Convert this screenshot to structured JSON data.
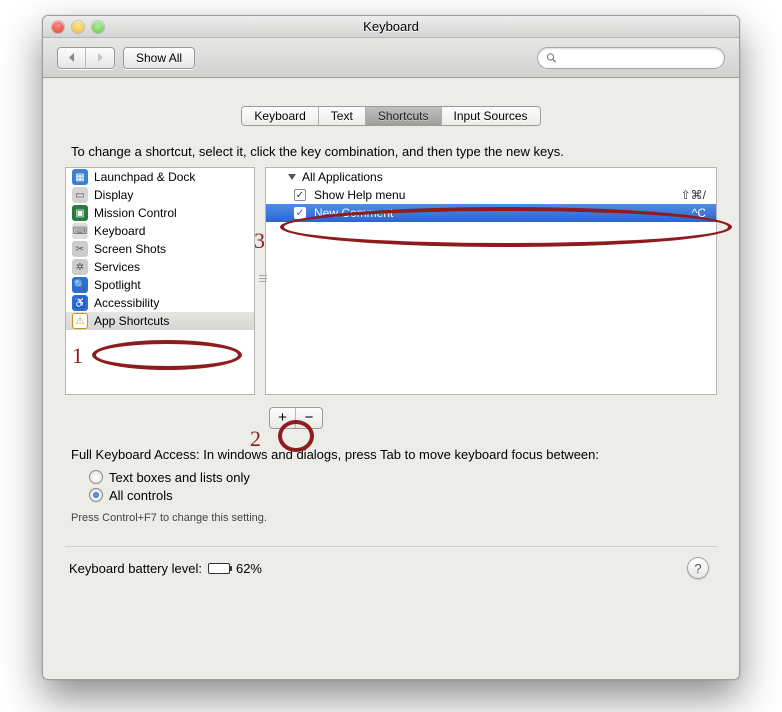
{
  "window": {
    "title": "Keyboard"
  },
  "toolbar": {
    "showAll": "Show All",
    "searchPlaceholder": ""
  },
  "tabs": {
    "items": [
      "Keyboard",
      "Text",
      "Shortcuts",
      "Input Sources"
    ],
    "activeIndex": 2
  },
  "instruction": "To change a shortcut, select it, click the key combination, and then type the new keys.",
  "sidebar": {
    "items": [
      {
        "label": "Launchpad & Dock",
        "icon": "launchpad",
        "color": "#3b7fd1"
      },
      {
        "label": "Display",
        "icon": "display",
        "color": "#5a5a5a"
      },
      {
        "label": "Mission Control",
        "icon": "mission",
        "color": "#2a7a3e"
      },
      {
        "label": "Keyboard",
        "icon": "keyboard",
        "color": "#9a9a9a"
      },
      {
        "label": "Screen Shots",
        "icon": "screenshot",
        "color": "#7a7a7a"
      },
      {
        "label": "Services",
        "icon": "services",
        "color": "#7a7a7a"
      },
      {
        "label": "Spotlight",
        "icon": "spotlight",
        "color": "#2a6fd6"
      },
      {
        "label": "Accessibility",
        "icon": "accessibility",
        "color": "#2a6fd6"
      },
      {
        "label": "App Shortcuts",
        "icon": "appshortcuts",
        "color": "#d48a1a"
      }
    ],
    "selectedIndex": 8
  },
  "tree": {
    "header": "All Applications",
    "rows": [
      {
        "checked": true,
        "label": "Show Help menu",
        "shortcut": "⇧⌘/",
        "selected": false
      },
      {
        "checked": true,
        "label": "New Comment",
        "shortcut": "^C",
        "selected": true
      }
    ]
  },
  "addRemove": {
    "add": "+",
    "remove": "−"
  },
  "fka": {
    "text": "Full Keyboard Access: In windows and dialogs, press Tab to move keyboard focus between:",
    "options": [
      "Text boxes and lists only",
      "All controls"
    ],
    "selectedIndex": 1,
    "hint": "Press Control+F7 to change this setting."
  },
  "battery": {
    "label": "Keyboard battery level:",
    "percent": "62%"
  },
  "help": "?",
  "annotations": {
    "n1": "1",
    "n2": "2",
    "n3": "3"
  }
}
